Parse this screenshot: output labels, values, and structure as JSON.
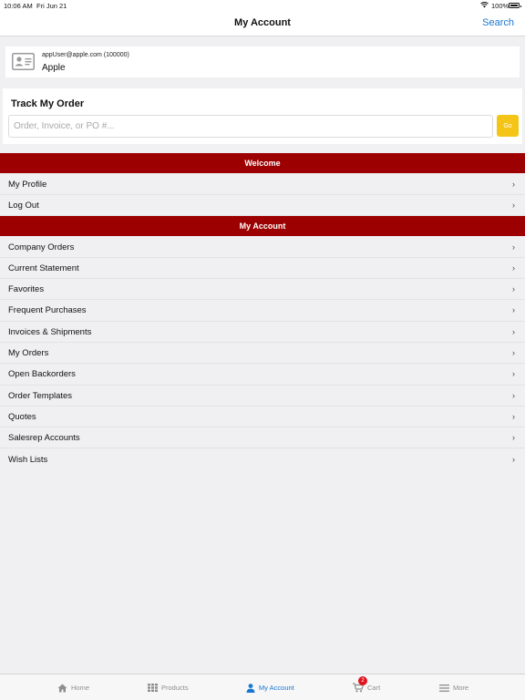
{
  "status_bar": {
    "time": "10:06 AM",
    "date": "Fri Jun 21",
    "battery": "100%"
  },
  "nav": {
    "title": "My Account",
    "search_label": "Search"
  },
  "user": {
    "email": "appUser@apple.com (100000)",
    "company": "Apple"
  },
  "track": {
    "title": "Track My Order",
    "placeholder": "Order, Invoice, or PO #...",
    "value": "",
    "go_label": "Go"
  },
  "welcome_section": {
    "header": "Welcome",
    "items": [
      {
        "label": "My Profile"
      },
      {
        "label": "Log Out"
      }
    ]
  },
  "account_section": {
    "header": "My Account",
    "items": [
      {
        "label": "Company Orders"
      },
      {
        "label": "Current Statement"
      },
      {
        "label": "Favorites"
      },
      {
        "label": "Frequent Purchases"
      },
      {
        "label": "Invoices & Shipments"
      },
      {
        "label": "My Orders"
      },
      {
        "label": "Open Backorders"
      },
      {
        "label": "Order Templates"
      },
      {
        "label": "Quotes"
      },
      {
        "label": "Salesrep Accounts"
      },
      {
        "label": "Wish Lists"
      }
    ]
  },
  "chevron": "›",
  "tabs": {
    "home": "Home",
    "products": "Products",
    "account": "My Account",
    "cart": "Cart",
    "cart_badge": "2",
    "more": "More"
  },
  "icons": {
    "statusbar": [
      "wifi-icon",
      "battery-icon"
    ],
    "user_card": "id-card-icon",
    "tabs": [
      "home-icon",
      "grid-icon",
      "person-icon",
      "cart-icon",
      "menu-icon"
    ]
  },
  "colors": {
    "section_header": "#9c0000",
    "accent": "#1877d2",
    "go_button": "#f4c517",
    "badge": "#e0141e"
  }
}
